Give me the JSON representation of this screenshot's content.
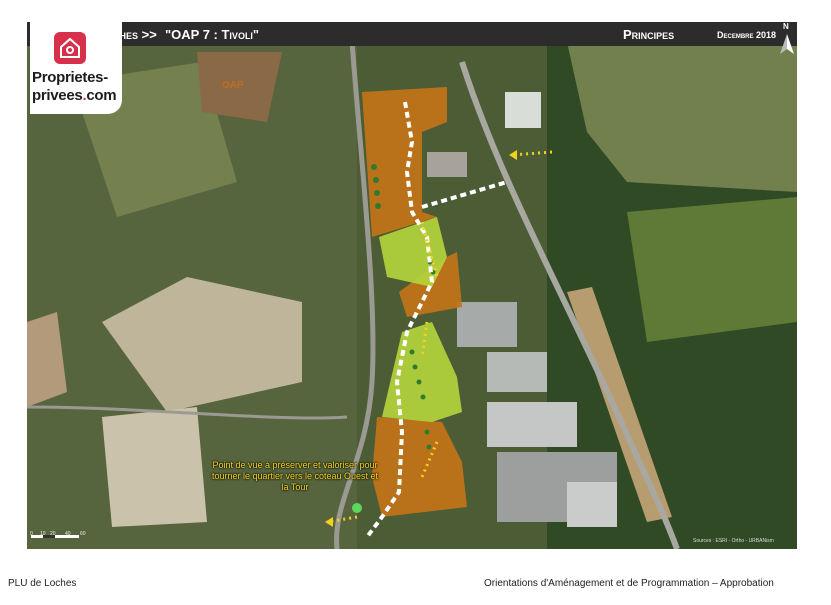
{
  "header": {
    "breadcrumb_prefix": "ches >>",
    "title": "\"OAP 7 : Tivoli\"",
    "section": "Principes",
    "date": "Decembre 2018"
  },
  "logo": {
    "line1": "Proprietes-",
    "line2_a": "privees",
    "line2_dot": ".",
    "line2_b": "com"
  },
  "map": {
    "oap_label": "OAP",
    "viewpoint_annotation": "Point de vue à préserver et valoriser pour tourner le quartier vers le coteau Ouest et la Tour",
    "source": "Sources : ESRI - Ortho - URBANism",
    "north": "N",
    "scale_labels": [
      "0",
      "10",
      "20",
      "40",
      "60"
    ]
  },
  "footer": {
    "left": "PLU de Loches",
    "right": "Orientations d'Aménagement et de Programmation – Approbation"
  },
  "colors": {
    "header_bg": "#2c2c2c",
    "zone_orange": "#c27418",
    "zone_green": "#b5d63c",
    "arrow_yellow": "#f5d020",
    "path_white": "#ffffff",
    "tree_green": "#2e7a2e",
    "brand_red": "#d6304a"
  }
}
